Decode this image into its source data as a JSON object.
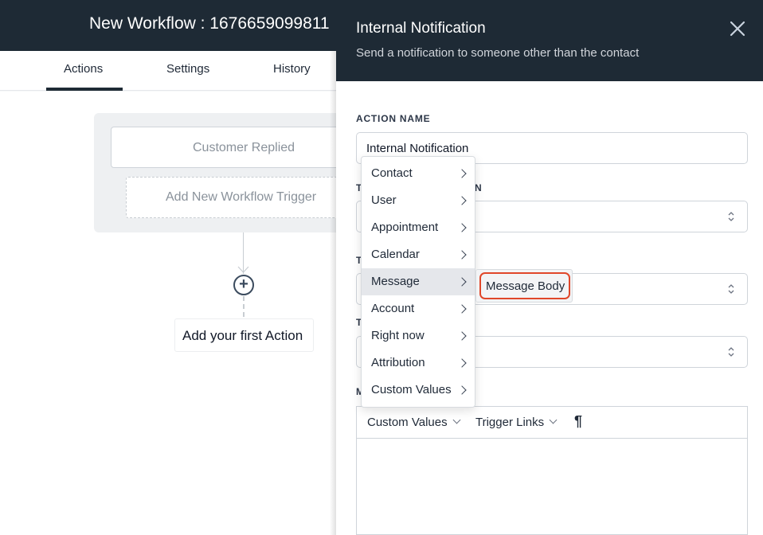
{
  "workflow": {
    "title": "New Workflow : 1676659099811",
    "tabs": [
      {
        "label": "Actions",
        "active": true
      },
      {
        "label": "Settings",
        "active": false
      },
      {
        "label": "History",
        "active": false
      }
    ],
    "trigger_card_label": "Customer Replied",
    "add_trigger_label": "Add New Workflow Trigger",
    "add_action_label": "Add your first Action",
    "plus_symbol": "+"
  },
  "drawer": {
    "title": "Internal Notification",
    "subtitle": "Send a notification to someone other than the contact",
    "action_name_label": "ACTION NAME",
    "action_name_value": "Internal Notification",
    "partial_label_2_prefix": "T",
    "partial_label_2_suffix": "N",
    "partial_label_3_prefix": "T",
    "partial_label_4_prefix": "T",
    "partial_label_5_prefix": "M",
    "editor_toolbar": {
      "custom_values": "Custom Values",
      "trigger_links": "Trigger Links",
      "paragraph_symbol": "¶"
    }
  },
  "menu": {
    "items": [
      {
        "label": "Contact"
      },
      {
        "label": "User"
      },
      {
        "label": "Appointment"
      },
      {
        "label": "Calendar"
      },
      {
        "label": "Message",
        "active": true
      },
      {
        "label": "Account"
      },
      {
        "label": "Right now"
      },
      {
        "label": "Attribution"
      },
      {
        "label": "Custom Values"
      }
    ],
    "submenu_item": "Message Body"
  },
  "colors": {
    "header_bg": "#1e2a35",
    "highlight_border": "#e0472a",
    "menu_active_bg": "#e5e7eb"
  }
}
